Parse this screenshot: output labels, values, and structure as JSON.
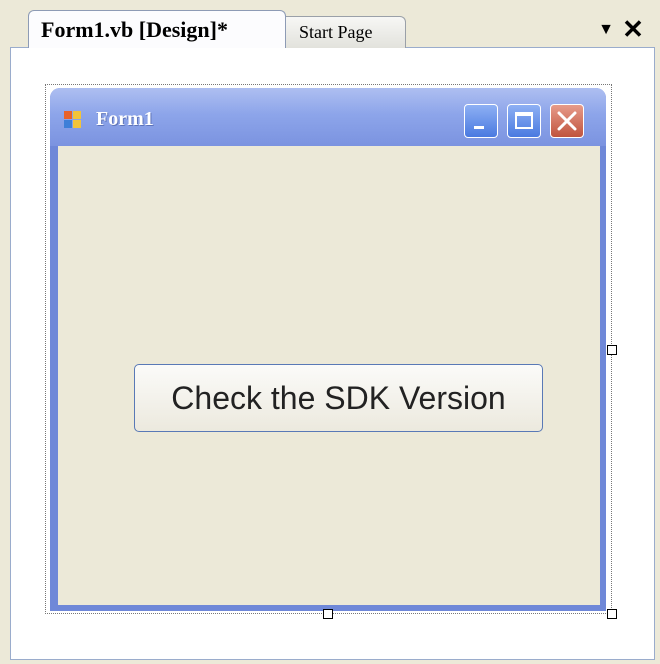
{
  "tabs": [
    {
      "label": "Form1.vb [Design]*",
      "active": true
    },
    {
      "label": "Start Page",
      "active": false
    }
  ],
  "tab_controls": {
    "dropdown_glyph": "▼",
    "close_glyph": "✕"
  },
  "form": {
    "title": "Form1",
    "icon": "form-icon",
    "caption_buttons": [
      "minimize-icon",
      "maximize-icon",
      "close-icon"
    ]
  },
  "controls": {
    "button_label": "Check the SDK Version"
  },
  "colors": {
    "titlebar": "#8da5ea",
    "client_area": "#ece9d8",
    "close_button": "#c0543e"
  }
}
